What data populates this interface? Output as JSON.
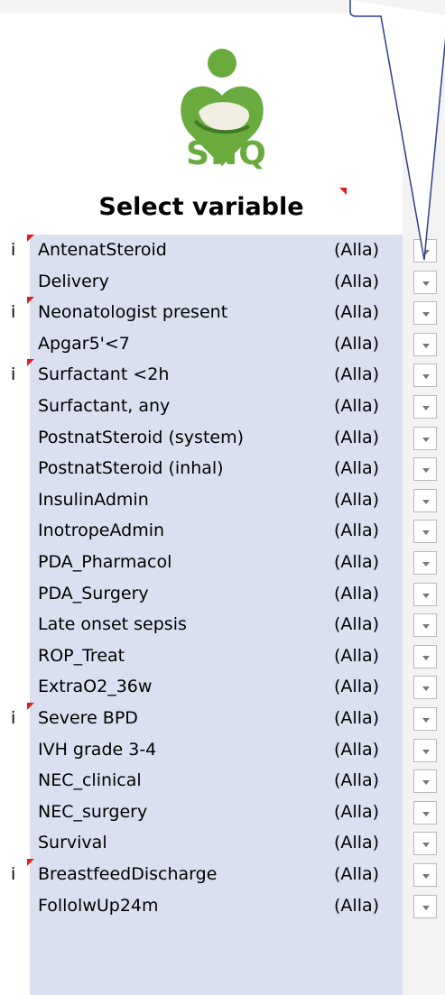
{
  "header": {
    "logo_text": "SNQ",
    "title": "Select variable"
  },
  "rows": [
    {
      "label": "AntenatSteroid",
      "value": "(Alla)",
      "info": "i"
    },
    {
      "label": "Delivery",
      "value": "(Alla)",
      "info": ""
    },
    {
      "label": "Neonatologist present",
      "value": "(Alla)",
      "info": "i"
    },
    {
      "label": "Apgar5'<7",
      "value": "(Alla)",
      "info": ""
    },
    {
      "label": "Surfactant <2h",
      "value": "(Alla)",
      "info": "i"
    },
    {
      "label": "Surfactant, any",
      "value": "(Alla)",
      "info": ""
    },
    {
      "label": "PostnatSteroid (system)",
      "value": "(Alla)",
      "info": ""
    },
    {
      "label": "PostnatSteroid (inhal)",
      "value": "(Alla)",
      "info": ""
    },
    {
      "label": "InsulinAdmin",
      "value": "(Alla)",
      "info": ""
    },
    {
      "label": "InotropeAdmin",
      "value": "(Alla)",
      "info": ""
    },
    {
      "label": "PDA_Pharmacol",
      "value": "(Alla)",
      "info": ""
    },
    {
      "label": "PDA_Surgery",
      "value": "(Alla)",
      "info": ""
    },
    {
      "label": "Late onset sepsis",
      "value": "(Alla)",
      "info": ""
    },
    {
      "label": "ROP_Treat",
      "value": "(Alla)",
      "info": ""
    },
    {
      "label": "ExtraO2_36w",
      "value": "(Alla)",
      "info": ""
    },
    {
      "label": "Severe BPD",
      "value": "(Alla)",
      "info": "i"
    },
    {
      "label": "IVH grade 3-4",
      "value": "(Alla)",
      "info": ""
    },
    {
      "label": "NEC_clinical",
      "value": "(Alla)",
      "info": ""
    },
    {
      "label": "NEC_surgery",
      "value": "(Alla)",
      "info": ""
    },
    {
      "label": "Survival",
      "value": "(Alla)",
      "info": ""
    },
    {
      "label": "BreastfeedDischarge",
      "value": "(Alla)",
      "info": "i"
    },
    {
      "label": "FollolwUp24m",
      "value": "(Alla)",
      "info": ""
    }
  ],
  "colors": {
    "brand_green": "#6aab3e",
    "panel": "#dae0f0",
    "comment_marker": "#e02020",
    "callout": "#2f3f8f"
  },
  "icons": {
    "logo": "snq-heart-logo-icon",
    "dropdown": "dropdown-arrow-icon",
    "comment": "comment-marker-icon"
  }
}
